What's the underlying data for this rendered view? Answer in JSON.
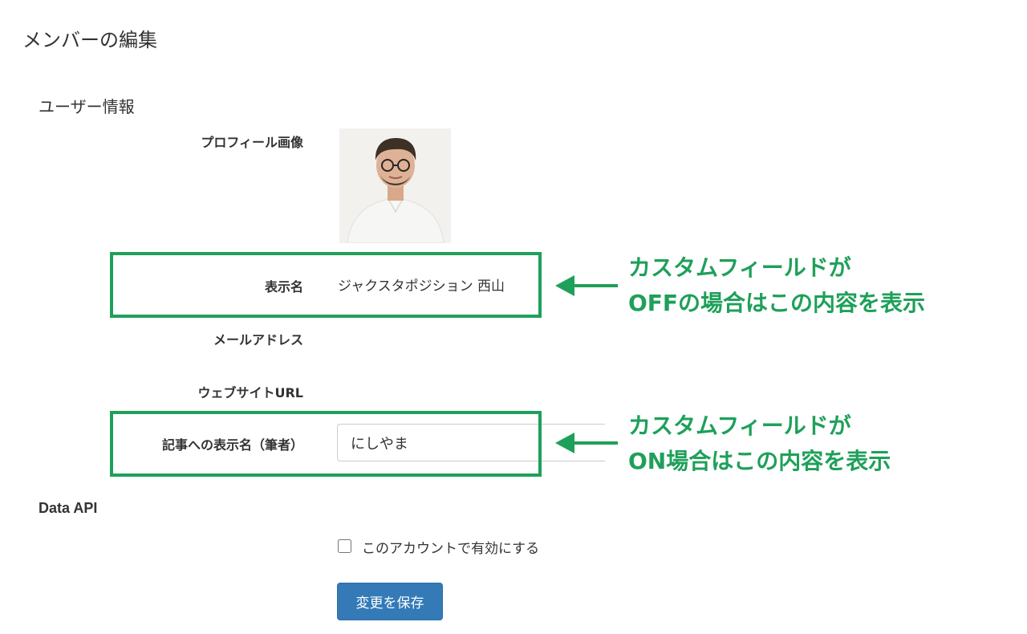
{
  "page": {
    "title": "メンバーの編集"
  },
  "user_info": {
    "section_title": "ユーザー情報",
    "profile_image_label": "プロフィール画像",
    "display_name_label": "表示名",
    "display_name_value": "ジャクスタポジション 西山",
    "email_label": "メールアドレス",
    "website_label": "ウェブサイトURL",
    "byline_label": "記事への表示名（筆者）",
    "byline_value": "にしやま"
  },
  "annotations": {
    "off_line1": "カスタムフィールドが",
    "off_line2": "OFFの場合はこの内容を表示",
    "on_line1": "カスタムフィールドが",
    "on_line2": "ON場合はこの内容を表示"
  },
  "data_api": {
    "section_title": "Data API",
    "enable_label": "このアカウントで有効にする",
    "enabled": false
  },
  "actions": {
    "save_label": "変更を保存"
  },
  "colors": {
    "highlight": "#1fa05a",
    "primary_button": "#337ab7",
    "text": "#333333"
  }
}
